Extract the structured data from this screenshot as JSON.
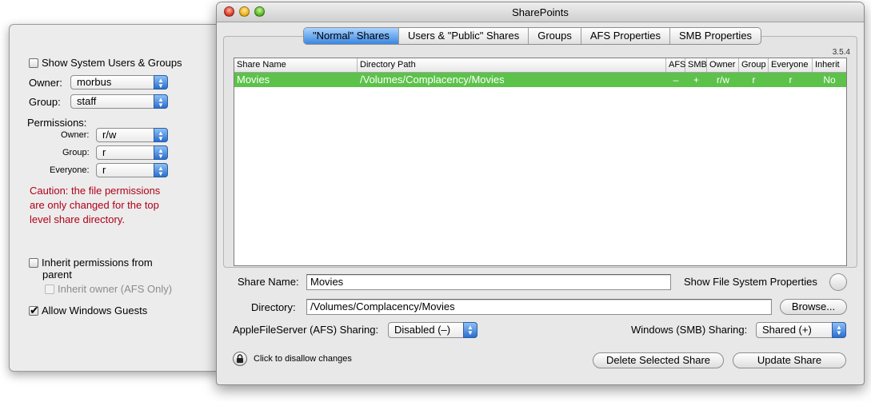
{
  "drawer": {
    "show_system": "Show System Users & Groups",
    "owner_label": "Owner:",
    "owner_value": "morbus",
    "group_label": "Group:",
    "group_value": "staff",
    "permissions_label": "Permissions:",
    "perm_owner_label": "Owner:",
    "perm_owner_value": "r/w",
    "perm_group_label": "Group:",
    "perm_group_value": "r",
    "perm_everyone_label": "Everyone:",
    "perm_everyone_value": "r",
    "caution_line1": "Caution: the file permissions",
    "caution_line2": "are only changed for the top",
    "caution_line3": "level share directory.",
    "inherit_line1": "Inherit permissions from",
    "inherit_line2": "parent",
    "inherit_owner": "Inherit owner (AFS Only)",
    "allow_guests": "Allow Windows Guests",
    "caution_color": "#b0001a"
  },
  "window": {
    "title": "SharePoints",
    "version": "3.5.4",
    "tabs": [
      {
        "label": "\"Normal\" Shares"
      },
      {
        "label": "Users & \"Public\" Shares"
      },
      {
        "label": "Groups"
      },
      {
        "label": "AFS Properties"
      },
      {
        "label": "SMB Properties"
      }
    ],
    "table": {
      "headers": [
        "Share Name",
        "Directory Path",
        "AFS",
        "SMB",
        "Owner",
        "Group",
        "Everyone",
        "Inherit"
      ],
      "rows": [
        {
          "name": "Movies",
          "path": "/Volumes/Complacency/Movies",
          "afs": "–",
          "smb": "+",
          "owner": "r/w",
          "group": "r",
          "everyone": "r",
          "inherit": "No"
        }
      ],
      "selection_color": "#5cc24a"
    },
    "form": {
      "share_name_label": "Share Name:",
      "share_name_value": "Movies",
      "show_fs_props": "Show File System Properties",
      "directory_label": "Directory:",
      "directory_value": "/Volumes/Complacency/Movies",
      "browse_label": "Browse...",
      "afs_label": "AppleFileServer (AFS) Sharing:",
      "afs_value": "Disabled (–)",
      "smb_label": "Windows (SMB) Sharing:",
      "smb_value": "Shared (+)",
      "lock_text": "Click to disallow changes",
      "delete_label": "Delete Selected Share",
      "update_label": "Update Share"
    }
  }
}
